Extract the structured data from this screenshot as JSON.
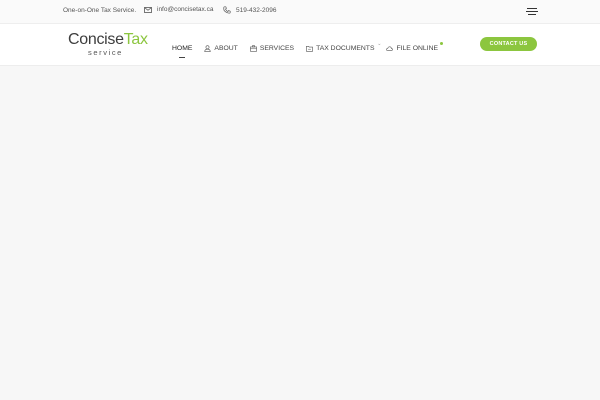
{
  "topbar": {
    "tagline": "One-on-One Tax Service.",
    "email": "info@concisetax.ca",
    "phone": "519-432-2096",
    "email_icon": "envelope-icon",
    "phone_icon": "phone-icon",
    "menu_icon": "hamburger-icon"
  },
  "logo": {
    "word1": "Concise",
    "word2": "Tax",
    "subtitle": "service"
  },
  "nav": {
    "items": [
      {
        "label": "HOME",
        "active": true
      },
      {
        "label": "ABOUT",
        "icon": "user-icon"
      },
      {
        "label": "SERVICES",
        "icon": "briefcase-icon"
      },
      {
        "label": "TAX DOCUMENTS",
        "icon": "folder-icon"
      },
      {
        "label": "FILE ONLINE",
        "icon": "cloud-icon"
      }
    ]
  },
  "contact_button": {
    "label": "CONTACT US"
  },
  "colors": {
    "accent": "#8cc63f",
    "text": "#444444",
    "background": "#f7f7f7"
  }
}
